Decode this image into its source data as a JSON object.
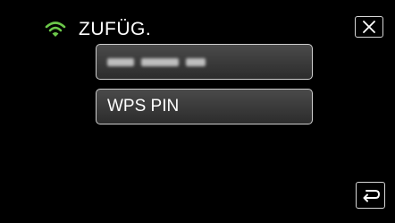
{
  "header": {
    "title": "ZUFÜG.",
    "status_icon": "wifi-icon",
    "status_color": "#6cc84a"
  },
  "buttons": {
    "close_icon": "close-icon",
    "back_icon": "return-arrow-icon"
  },
  "list": {
    "items": [
      {
        "label": "",
        "masked": true
      },
      {
        "label": "WPS PIN"
      }
    ]
  }
}
